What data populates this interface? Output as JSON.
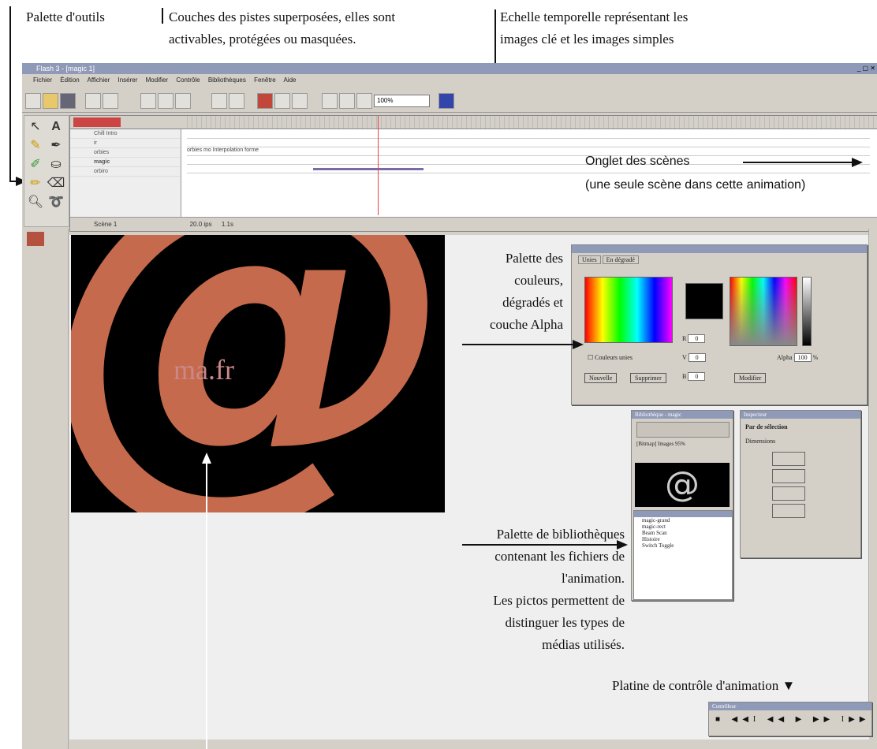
{
  "annotations": {
    "tools_palette": "Palette d'outils",
    "layers_line1": "Couches des pistes superposées, elles sont",
    "layers_line2": "activables, protégées ou masquées.",
    "timeline_line1": "Echelle temporelle représentant les",
    "timeline_line2": "images clé et les images simples",
    "scenes_line1": "Onglet des scènes",
    "scenes_line2": "(une seule scène dans cette animation)",
    "colors_line1": "Palette des",
    "colors_line2": "couleurs,",
    "colors_line3": "dégradés et",
    "colors_line4": "couche Alpha",
    "library_line1": "Palette de bibliothèques",
    "library_line2": "contenant les fichiers de",
    "library_line3": "l'animation.",
    "library_line4": "Les pictos permettent de",
    "library_line5": "distinguer les types de",
    "library_line6": "médias utilisés.",
    "controller": "Platine de contrôle d'animation ▼"
  },
  "app": {
    "title": "Flash 3 - [magic 1]",
    "menus": [
      "Fichier",
      "Édition",
      "Affichier",
      "Insérer",
      "Modifier",
      "Contrôle",
      "Bibliothèques",
      "Fenêtre",
      "Aide"
    ],
    "zoom": "100%",
    "scene_tab": "Scène 1",
    "timeline_status": [
      "20.0 ips",
      "1.1s"
    ],
    "layers": [
      "Chill Intro",
      "ir",
      "orbies",
      "magic",
      "orbiro"
    ],
    "tween_label": "orbies mo Interpolation forme",
    "art_text": "ma.fr"
  },
  "colors_panel": {
    "tabs": [
      "Unies",
      "En dégradé"
    ],
    "r_label": "R",
    "g_label": "V",
    "b_label": "B",
    "r": "0",
    "g": "0",
    "b": "0",
    "alpha_label": "Alpha",
    "alpha": "100",
    "alpha_unit": "%",
    "checkbox": "Couleurs unies",
    "buttons": [
      "Nouvelle",
      "Supprimer",
      "Modifier"
    ]
  },
  "library_panel": {
    "title": "Bibliothèque - magic",
    "preview_caption": "[Bitmap] Images 95%",
    "items": [
      "magic-grand",
      "magic-rect",
      "Beam Scan",
      "Histoire",
      "Switch Toggle"
    ]
  },
  "inspector_panel": {
    "title": "Inspecteur",
    "label": "Par de sélection",
    "sub": "Dimensions"
  },
  "controller_panel": {
    "title": "Contrôleur",
    "buttons": [
      "■",
      "◀◀I",
      "◀◀",
      "▶",
      "▶▶",
      "I▶▶"
    ]
  }
}
